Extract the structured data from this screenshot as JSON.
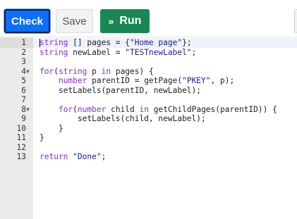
{
  "toolbar": {
    "check_label": "Check",
    "save_label": "Save",
    "run_icon": "»",
    "run_label": "Run"
  },
  "editor": {
    "lines": [
      {
        "n": "1",
        "text": "string [] pages = {\"Home page\"};"
      },
      {
        "n": "2",
        "text": "string newLabel = \"TESTnewLabel\";"
      },
      {
        "n": "3",
        "text": ""
      },
      {
        "n": "4",
        "text": "for(string p in pages) {",
        "fold": true
      },
      {
        "n": "5",
        "text": "    number parentID = getPage(\"PKEY\", p);"
      },
      {
        "n": "6",
        "text": "    setLabels(parentID, newLabel);"
      },
      {
        "n": "7",
        "text": ""
      },
      {
        "n": "8",
        "text": "    for(number child in getChildPages(parentID)) {",
        "fold": true
      },
      {
        "n": "9",
        "text": "        setLabels(child, newLabel);"
      },
      {
        "n": "10",
        "text": "    }"
      },
      {
        "n": "11",
        "text": "}"
      },
      {
        "n": "12",
        "text": ""
      },
      {
        "n": "13",
        "text": "return \"Done\";"
      }
    ],
    "active_line": 1,
    "colors": {
      "keyword": "#8a2be2",
      "string": "#1a1aa6",
      "gutter": "#ebebeb"
    }
  }
}
